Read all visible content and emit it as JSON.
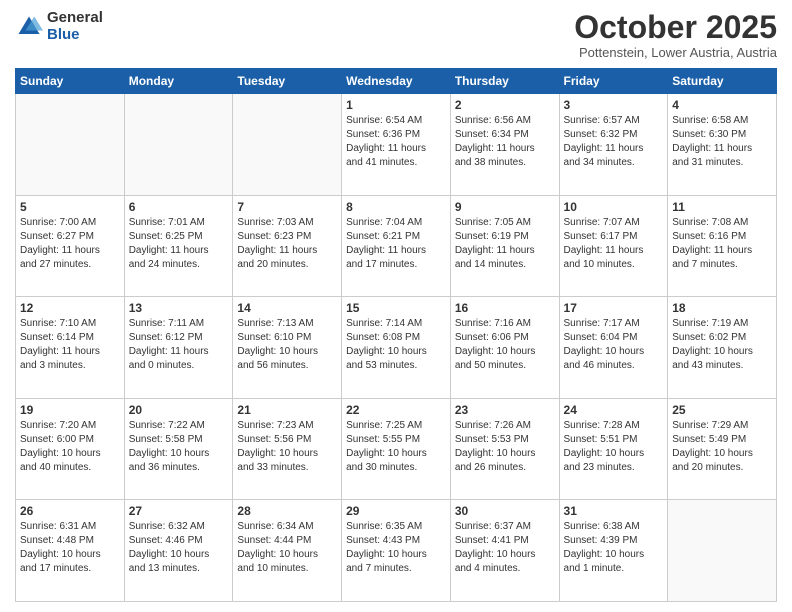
{
  "header": {
    "logo_general": "General",
    "logo_blue": "Blue",
    "month_title": "October 2025",
    "subtitle": "Pottenstein, Lower Austria, Austria"
  },
  "calendar": {
    "weekdays": [
      "Sunday",
      "Monday",
      "Tuesday",
      "Wednesday",
      "Thursday",
      "Friday",
      "Saturday"
    ],
    "weeks": [
      [
        {
          "day": "",
          "info": ""
        },
        {
          "day": "",
          "info": ""
        },
        {
          "day": "",
          "info": ""
        },
        {
          "day": "1",
          "info": "Sunrise: 6:54 AM\nSunset: 6:36 PM\nDaylight: 11 hours\nand 41 minutes."
        },
        {
          "day": "2",
          "info": "Sunrise: 6:56 AM\nSunset: 6:34 PM\nDaylight: 11 hours\nand 38 minutes."
        },
        {
          "day": "3",
          "info": "Sunrise: 6:57 AM\nSunset: 6:32 PM\nDaylight: 11 hours\nand 34 minutes."
        },
        {
          "day": "4",
          "info": "Sunrise: 6:58 AM\nSunset: 6:30 PM\nDaylight: 11 hours\nand 31 minutes."
        }
      ],
      [
        {
          "day": "5",
          "info": "Sunrise: 7:00 AM\nSunset: 6:27 PM\nDaylight: 11 hours\nand 27 minutes."
        },
        {
          "day": "6",
          "info": "Sunrise: 7:01 AM\nSunset: 6:25 PM\nDaylight: 11 hours\nand 24 minutes."
        },
        {
          "day": "7",
          "info": "Sunrise: 7:03 AM\nSunset: 6:23 PM\nDaylight: 11 hours\nand 20 minutes."
        },
        {
          "day": "8",
          "info": "Sunrise: 7:04 AM\nSunset: 6:21 PM\nDaylight: 11 hours\nand 17 minutes."
        },
        {
          "day": "9",
          "info": "Sunrise: 7:05 AM\nSunset: 6:19 PM\nDaylight: 11 hours\nand 14 minutes."
        },
        {
          "day": "10",
          "info": "Sunrise: 7:07 AM\nSunset: 6:17 PM\nDaylight: 11 hours\nand 10 minutes."
        },
        {
          "day": "11",
          "info": "Sunrise: 7:08 AM\nSunset: 6:16 PM\nDaylight: 11 hours\nand 7 minutes."
        }
      ],
      [
        {
          "day": "12",
          "info": "Sunrise: 7:10 AM\nSunset: 6:14 PM\nDaylight: 11 hours\nand 3 minutes."
        },
        {
          "day": "13",
          "info": "Sunrise: 7:11 AM\nSunset: 6:12 PM\nDaylight: 11 hours\nand 0 minutes."
        },
        {
          "day": "14",
          "info": "Sunrise: 7:13 AM\nSunset: 6:10 PM\nDaylight: 10 hours\nand 56 minutes."
        },
        {
          "day": "15",
          "info": "Sunrise: 7:14 AM\nSunset: 6:08 PM\nDaylight: 10 hours\nand 53 minutes."
        },
        {
          "day": "16",
          "info": "Sunrise: 7:16 AM\nSunset: 6:06 PM\nDaylight: 10 hours\nand 50 minutes."
        },
        {
          "day": "17",
          "info": "Sunrise: 7:17 AM\nSunset: 6:04 PM\nDaylight: 10 hours\nand 46 minutes."
        },
        {
          "day": "18",
          "info": "Sunrise: 7:19 AM\nSunset: 6:02 PM\nDaylight: 10 hours\nand 43 minutes."
        }
      ],
      [
        {
          "day": "19",
          "info": "Sunrise: 7:20 AM\nSunset: 6:00 PM\nDaylight: 10 hours\nand 40 minutes."
        },
        {
          "day": "20",
          "info": "Sunrise: 7:22 AM\nSunset: 5:58 PM\nDaylight: 10 hours\nand 36 minutes."
        },
        {
          "day": "21",
          "info": "Sunrise: 7:23 AM\nSunset: 5:56 PM\nDaylight: 10 hours\nand 33 minutes."
        },
        {
          "day": "22",
          "info": "Sunrise: 7:25 AM\nSunset: 5:55 PM\nDaylight: 10 hours\nand 30 minutes."
        },
        {
          "day": "23",
          "info": "Sunrise: 7:26 AM\nSunset: 5:53 PM\nDaylight: 10 hours\nand 26 minutes."
        },
        {
          "day": "24",
          "info": "Sunrise: 7:28 AM\nSunset: 5:51 PM\nDaylight: 10 hours\nand 23 minutes."
        },
        {
          "day": "25",
          "info": "Sunrise: 7:29 AM\nSunset: 5:49 PM\nDaylight: 10 hours\nand 20 minutes."
        }
      ],
      [
        {
          "day": "26",
          "info": "Sunrise: 6:31 AM\nSunset: 4:48 PM\nDaylight: 10 hours\nand 17 minutes."
        },
        {
          "day": "27",
          "info": "Sunrise: 6:32 AM\nSunset: 4:46 PM\nDaylight: 10 hours\nand 13 minutes."
        },
        {
          "day": "28",
          "info": "Sunrise: 6:34 AM\nSunset: 4:44 PM\nDaylight: 10 hours\nand 10 minutes."
        },
        {
          "day": "29",
          "info": "Sunrise: 6:35 AM\nSunset: 4:43 PM\nDaylight: 10 hours\nand 7 minutes."
        },
        {
          "day": "30",
          "info": "Sunrise: 6:37 AM\nSunset: 4:41 PM\nDaylight: 10 hours\nand 4 minutes."
        },
        {
          "day": "31",
          "info": "Sunrise: 6:38 AM\nSunset: 4:39 PM\nDaylight: 10 hours\nand 1 minute."
        },
        {
          "day": "",
          "info": ""
        }
      ]
    ]
  }
}
